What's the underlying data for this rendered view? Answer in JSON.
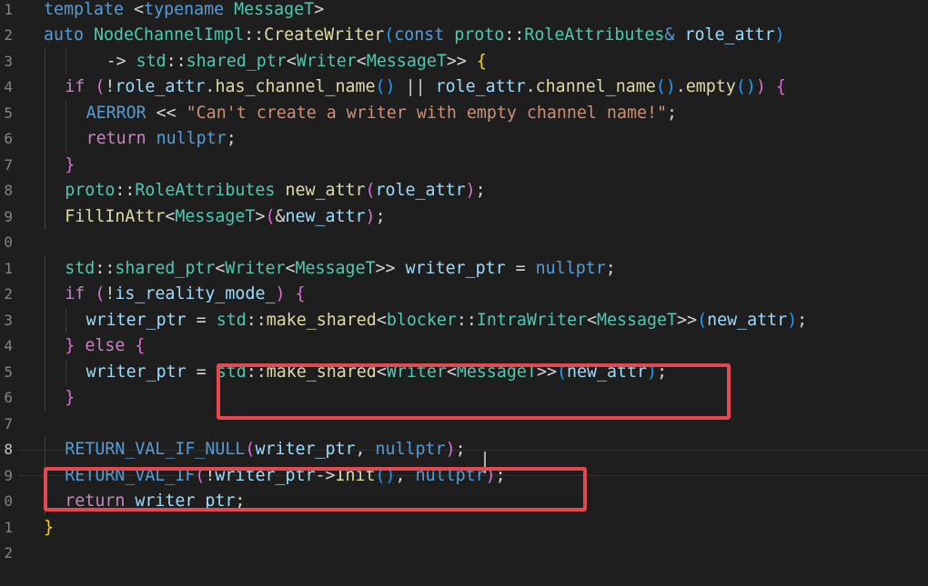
{
  "colors": {
    "background": "#1e1e1e",
    "keyword": "#569cd6",
    "control": "#c586c0",
    "function": "#dcdcaa",
    "type": "#4ec9b0",
    "variable": "#9cdcfe",
    "string": "#ce9178",
    "plain": "#d4d4d4",
    "bracket_gold": "#ffd700",
    "bracket_orchid": "#da70d6",
    "bracket_blue": "#179fff",
    "highlight_box": "#e5494f"
  },
  "gutter": {
    "line_numbers": [
      "1",
      "2",
      "3",
      "4",
      "5",
      "6",
      "7",
      "8",
      "9",
      "0",
      "1",
      "2",
      "3",
      "4",
      "5",
      "6",
      "7",
      "8",
      "9",
      "0",
      "1",
      "2"
    ],
    "active_index": 17
  },
  "lines": [
    [
      [
        "kw",
        "template "
      ],
      [
        "p",
        "<"
      ],
      [
        "kw",
        "typename "
      ],
      [
        "ty",
        "MessageT"
      ],
      [
        "p",
        ">"
      ]
    ],
    [
      [
        "kw",
        "auto "
      ],
      [
        "ty",
        "NodeChannelImpl"
      ],
      [
        "p",
        "::"
      ],
      [
        "fn",
        "CreateWriter"
      ],
      [
        "b3",
        "("
      ],
      [
        "kw",
        "const "
      ],
      [
        "ty",
        "proto"
      ],
      [
        "p",
        "::"
      ],
      [
        "ty",
        "RoleAttributes"
      ],
      [
        "kw",
        "& "
      ],
      [
        "var",
        "role_attr"
      ],
      [
        "b3",
        ")"
      ]
    ],
    [
      [
        "p",
        "  -> "
      ],
      [
        "ty",
        "std"
      ],
      [
        "p",
        "::"
      ],
      [
        "ty",
        "shared_ptr"
      ],
      [
        "p",
        "<"
      ],
      [
        "ty",
        "Writer"
      ],
      [
        "p",
        "<"
      ],
      [
        "ty",
        "MessageT"
      ],
      [
        "p",
        ">> "
      ],
      [
        "b1",
        "{"
      ]
    ],
    [
      [
        "ctl",
        "if "
      ],
      [
        "b2",
        "("
      ],
      [
        "p",
        "!"
      ],
      [
        "var",
        "role_attr"
      ],
      [
        "p",
        "."
      ],
      [
        "fn",
        "has_channel_name"
      ],
      [
        "b3",
        "()"
      ],
      [
        "p",
        " || "
      ],
      [
        "var",
        "role_attr"
      ],
      [
        "p",
        "."
      ],
      [
        "fn",
        "channel_name"
      ],
      [
        "b3",
        "()"
      ],
      [
        "p",
        "."
      ],
      [
        "fn",
        "empty"
      ],
      [
        "b3",
        "()"
      ],
      [
        "b2",
        ")"
      ],
      [
        "p",
        " "
      ],
      [
        "b2",
        "{"
      ]
    ],
    [
      [
        "mac",
        "AERROR"
      ],
      [
        "p",
        " << "
      ],
      [
        "str",
        "\"Can't create a writer with empty channel name!\""
      ],
      [
        "p",
        ";"
      ]
    ],
    [
      [
        "ctl",
        "return "
      ],
      [
        "kw",
        "nullptr"
      ],
      [
        "p",
        ";"
      ]
    ],
    [
      [
        "b2",
        "}"
      ]
    ],
    [
      [
        "ty",
        "proto"
      ],
      [
        "p",
        "::"
      ],
      [
        "ty",
        "RoleAttributes"
      ],
      [
        "p",
        " "
      ],
      [
        "fn",
        "new_attr"
      ],
      [
        "b2",
        "("
      ],
      [
        "var",
        "role_attr"
      ],
      [
        "b2",
        ")"
      ],
      [
        "p",
        ";"
      ]
    ],
    [
      [
        "fn",
        "FillInAttr"
      ],
      [
        "p",
        "<"
      ],
      [
        "ty",
        "MessageT"
      ],
      [
        "p",
        ">"
      ],
      [
        "b2",
        "("
      ],
      [
        "p",
        "&"
      ],
      [
        "var",
        "new_attr"
      ],
      [
        "b2",
        ")"
      ],
      [
        "p",
        ";"
      ]
    ],
    [],
    [
      [
        "ty",
        "std"
      ],
      [
        "p",
        "::"
      ],
      [
        "ty",
        "shared_ptr"
      ],
      [
        "p",
        "<"
      ],
      [
        "ty",
        "Writer"
      ],
      [
        "p",
        "<"
      ],
      [
        "ty",
        "MessageT"
      ],
      [
        "p",
        ">> "
      ],
      [
        "var",
        "writer_ptr"
      ],
      [
        "p",
        " = "
      ],
      [
        "kw",
        "nullptr"
      ],
      [
        "p",
        ";"
      ]
    ],
    [
      [
        "ctl",
        "if "
      ],
      [
        "b2",
        "("
      ],
      [
        "p",
        "!"
      ],
      [
        "var",
        "is_reality_mode_"
      ],
      [
        "b2",
        ")"
      ],
      [
        "p",
        " "
      ],
      [
        "b2",
        "{"
      ]
    ],
    [
      [
        "var",
        "writer_ptr"
      ],
      [
        "p",
        " = "
      ],
      [
        "ty",
        "std"
      ],
      [
        "p",
        "::"
      ],
      [
        "fn",
        "make_shared"
      ],
      [
        "p",
        "<"
      ],
      [
        "ty",
        "blocker"
      ],
      [
        "p",
        "::"
      ],
      [
        "ty",
        "IntraWriter"
      ],
      [
        "p",
        "<"
      ],
      [
        "ty",
        "MessageT"
      ],
      [
        "p",
        ">>"
      ],
      [
        "b3",
        "("
      ],
      [
        "var",
        "new_attr"
      ],
      [
        "b3",
        ")"
      ],
      [
        "p",
        ";"
      ]
    ],
    [
      [
        "b2",
        "}"
      ],
      [
        "p",
        " "
      ],
      [
        "ctl",
        "else "
      ],
      [
        "b2",
        "{"
      ]
    ],
    [
      [
        "var",
        "writer_ptr"
      ],
      [
        "p",
        " = "
      ],
      [
        "ty",
        "std"
      ],
      [
        "p",
        "::"
      ],
      [
        "fn",
        "make_shared"
      ],
      [
        "p",
        "<"
      ],
      [
        "ty",
        "Writer"
      ],
      [
        "p",
        "<"
      ],
      [
        "ty",
        "MessageT"
      ],
      [
        "p",
        ">>"
      ],
      [
        "b3",
        "("
      ],
      [
        "var",
        "new_attr"
      ],
      [
        "b3",
        ")"
      ],
      [
        "p",
        ";"
      ]
    ],
    [
      [
        "b2",
        "}"
      ]
    ],
    [],
    [
      [
        "mac",
        "RETURN_VAL_IF_NULL"
      ],
      [
        "b2",
        "("
      ],
      [
        "var",
        "writer_ptr"
      ],
      [
        "p",
        ", "
      ],
      [
        "kw",
        "nullptr"
      ],
      [
        "b2",
        ")"
      ],
      [
        "p",
        ";"
      ]
    ],
    [
      [
        "mac",
        "RETURN_VAL_IF"
      ],
      [
        "b2",
        "("
      ],
      [
        "p",
        "!"
      ],
      [
        "var",
        "writer_ptr"
      ],
      [
        "p",
        "->"
      ],
      [
        "fn",
        "Init"
      ],
      [
        "b3",
        "()"
      ],
      [
        "p",
        ", "
      ],
      [
        "kw",
        "nullptr"
      ],
      [
        "b2",
        ")"
      ],
      [
        "p",
        ";"
      ]
    ],
    [
      [
        "ctl",
        "return "
      ],
      [
        "var",
        "writer_ptr"
      ],
      [
        "p",
        ";"
      ]
    ],
    [
      [
        "b1",
        "}"
      ]
    ],
    []
  ]
}
